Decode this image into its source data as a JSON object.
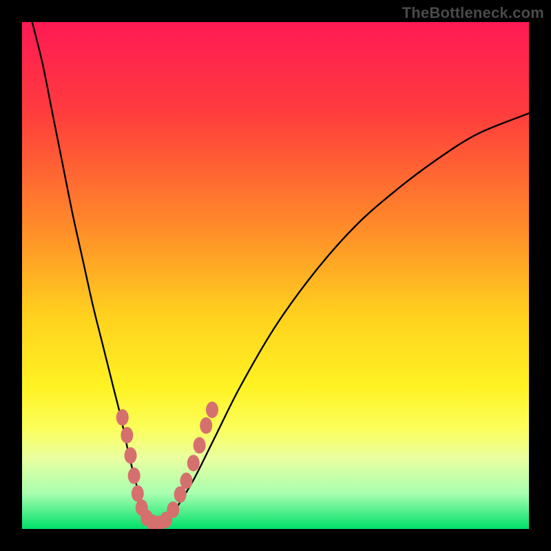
{
  "watermark": "TheBottleneck.com",
  "chart_data": {
    "type": "line",
    "title": "",
    "xlabel": "",
    "ylabel": "",
    "xlim": [
      0,
      100
    ],
    "ylim": [
      0,
      100
    ],
    "grid": false,
    "legend": false,
    "gradient_stops": [
      {
        "offset": 0.0,
        "color": "#ff1a55"
      },
      {
        "offset": 0.18,
        "color": "#ff3d3d"
      },
      {
        "offset": 0.4,
        "color": "#ff8a2a"
      },
      {
        "offset": 0.58,
        "color": "#ffd21e"
      },
      {
        "offset": 0.72,
        "color": "#fff324"
      },
      {
        "offset": 0.8,
        "color": "#fcff5a"
      },
      {
        "offset": 0.86,
        "color": "#eaffa0"
      },
      {
        "offset": 0.93,
        "color": "#a8ffb0"
      },
      {
        "offset": 1.0,
        "color": "#00e06a"
      }
    ],
    "series": [
      {
        "name": "bottleneck-curve",
        "x": [
          2,
          4,
          6,
          8,
          10,
          12,
          14,
          16,
          18,
          19.5,
          21,
          22.5,
          24,
          25.5,
          27,
          29,
          31,
          34,
          38,
          43,
          50,
          58,
          66,
          74,
          82,
          90,
          100
        ],
        "y": [
          100,
          92,
          82,
          72,
          62,
          53,
          44,
          36,
          28,
          22,
          15,
          9,
          4,
          1.5,
          1,
          2,
          5,
          10,
          18,
          28,
          40,
          51,
          60,
          67,
          73,
          78,
          82
        ]
      }
    ],
    "markers": {
      "name": "highlight-dots",
      "points": [
        {
          "x": 19.8,
          "y": 22.0
        },
        {
          "x": 20.7,
          "y": 18.5
        },
        {
          "x": 21.4,
          "y": 14.5
        },
        {
          "x": 22.1,
          "y": 10.5
        },
        {
          "x": 22.8,
          "y": 7.0
        },
        {
          "x": 23.6,
          "y": 4.2
        },
        {
          "x": 24.6,
          "y": 2.2
        },
        {
          "x": 25.8,
          "y": 1.2
        },
        {
          "x": 27.0,
          "y": 1.0
        },
        {
          "x": 28.4,
          "y": 1.8
        },
        {
          "x": 29.8,
          "y": 3.8
        },
        {
          "x": 31.2,
          "y": 6.8
        },
        {
          "x": 32.4,
          "y": 9.5
        },
        {
          "x": 33.8,
          "y": 13.0
        },
        {
          "x": 35.0,
          "y": 16.5
        },
        {
          "x": 36.3,
          "y": 20.4
        },
        {
          "x": 37.5,
          "y": 23.5
        }
      ],
      "rx": 9,
      "ry": 12,
      "color": "#d6706e"
    }
  }
}
